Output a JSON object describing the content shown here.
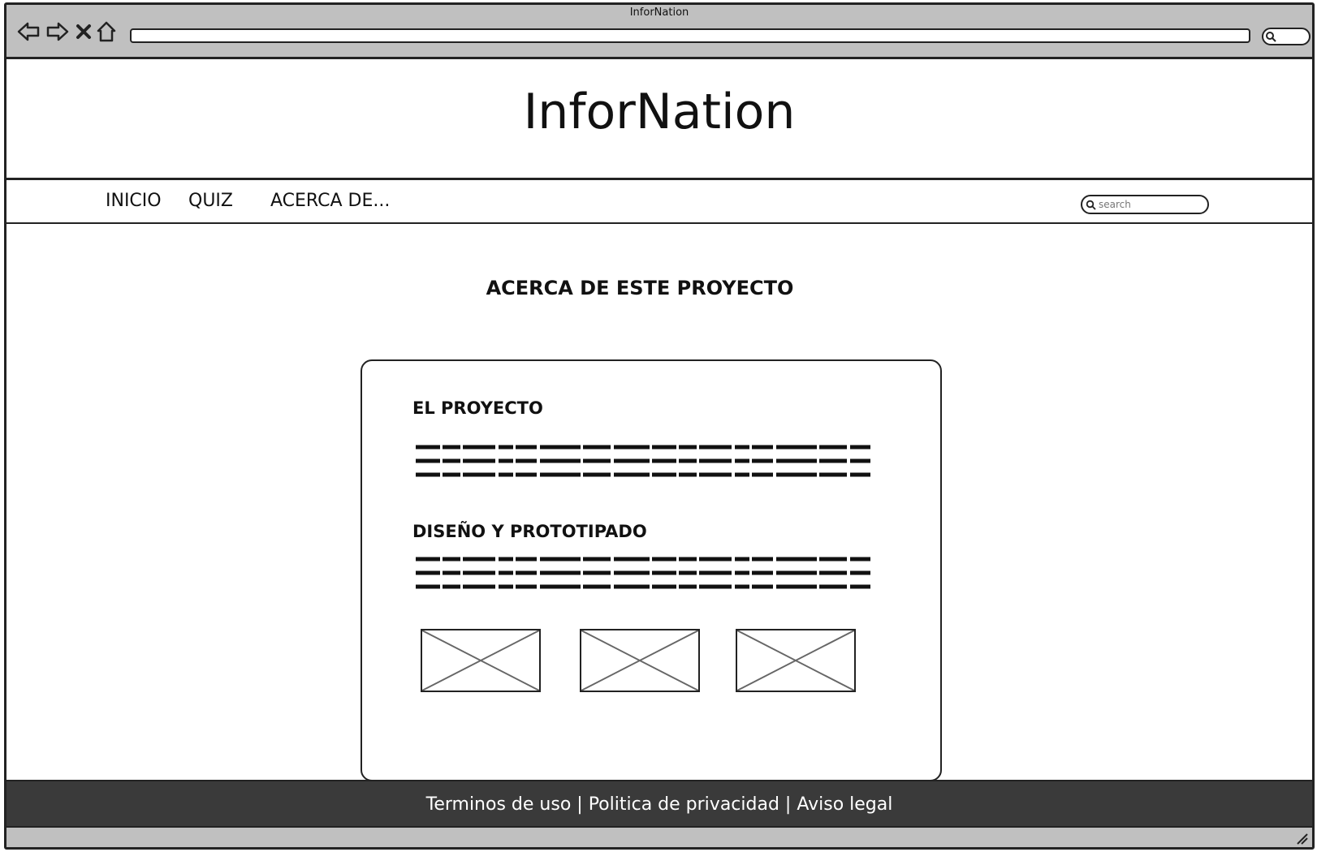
{
  "browser": {
    "title": "InforNation"
  },
  "site": {
    "title": "InforNation"
  },
  "nav": {
    "items": [
      {
        "label": "INICIO"
      },
      {
        "label": "QUIZ"
      },
      {
        "label": "ACERCA DE..."
      }
    ],
    "search_placeholder": "search"
  },
  "main": {
    "heading": "ACERCA DE ESTE PROYECTO",
    "sections": [
      {
        "title": "EL PROYECTO"
      },
      {
        "title": "DISEÑO Y PROTOTIPADO"
      }
    ],
    "image_count": 3
  },
  "footer": {
    "links": [
      "Terminos de uso",
      "Politica de privacidad",
      "Aviso legal"
    ],
    "separator": "|"
  },
  "colors": {
    "chrome": "#c0c0c0",
    "footer_bg": "#3a3a3a",
    "stroke": "#222222"
  },
  "icons": {
    "back": "back-arrow-icon",
    "forward": "forward-arrow-icon",
    "stop": "close-icon",
    "home": "home-icon",
    "search": "search-icon",
    "image": "image-placeholder-icon",
    "resize": "resize-grip-icon"
  }
}
